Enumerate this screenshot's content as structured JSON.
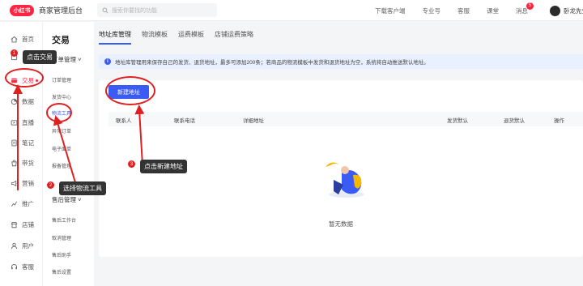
{
  "header": {
    "logo_text": "小红书",
    "app_title": "商家管理后台",
    "search_placeholder": "搜索你要找的功能",
    "links": [
      "下载客户端",
      "专业号",
      "客服",
      "课堂",
      "消息"
    ],
    "message_badge": "5",
    "username": "卧龙先生"
  },
  "sidebar": {
    "items": [
      {
        "label": "首页",
        "icon": "home-icon"
      },
      {
        "label": "商品",
        "icon": "goods-icon"
      },
      {
        "label": "交易",
        "icon": "trade-icon"
      },
      {
        "label": "数据",
        "icon": "data-icon"
      },
      {
        "label": "直播",
        "icon": "live-icon"
      },
      {
        "label": "笔记",
        "icon": "note-icon"
      },
      {
        "label": "带货",
        "icon": "sell-icon"
      },
      {
        "label": "营销",
        "icon": "marketing-icon"
      },
      {
        "label": "推广",
        "icon": "promote-icon"
      },
      {
        "label": "店铺",
        "icon": "store-icon"
      },
      {
        "label": "用户",
        "icon": "user-icon"
      },
      {
        "label": "客服",
        "icon": "service-icon"
      }
    ]
  },
  "subnav": {
    "title": "交易",
    "group1": "订单管理",
    "group1_items": [
      "订单管理",
      "发货中心",
      "物流工具",
      "异常订单",
      "电子面单",
      "报备管理"
    ],
    "group2": "售后管理",
    "group2_items": [
      "售后工作台",
      "取消管理",
      "售后助手",
      "售后设置"
    ]
  },
  "main": {
    "tabs": [
      "地址库管理",
      "物流模板",
      "运费模板",
      "店铺运费策略"
    ],
    "info_text": "地址库管理用来保存自己的发货、退货地址，最多可添加200条；若商品的物流模板中发货和退货地址为空，系统将自动推送默认地址。",
    "new_button": "新建地址",
    "columns": [
      "联系人",
      "联系电话",
      "详细地址",
      "发货默认",
      "退货默认",
      "操作"
    ],
    "empty_text": "暂无数据"
  },
  "annotations": {
    "step1": {
      "num": "1",
      "text": "点击交易"
    },
    "step2": {
      "num": "2",
      "text": "选择物流工具"
    },
    "step3": {
      "num": "3",
      "text": "点击新建地址"
    }
  },
  "colors": {
    "brand": "#ff2442",
    "accent": "#3a5cf5",
    "annotation": "#e02020"
  }
}
